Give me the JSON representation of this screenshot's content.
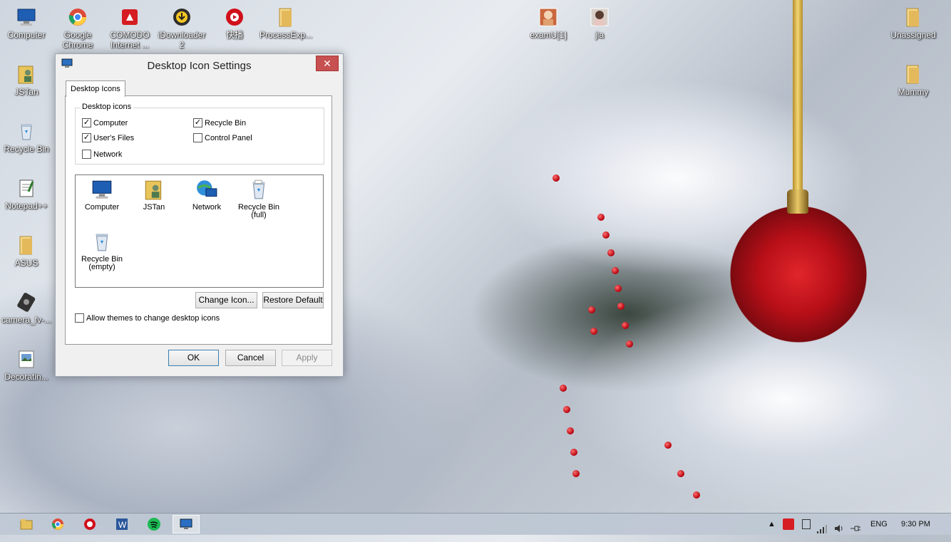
{
  "desktop": {
    "icons_left": [
      {
        "label": "Computer",
        "icon": "computer-icon"
      },
      {
        "label": "JSTan",
        "icon": "user-folder-icon"
      },
      {
        "label": "Recycle Bin",
        "icon": "recycle-bin-icon"
      },
      {
        "label": "Notepad++",
        "icon": "notepad-plus-plus-icon"
      },
      {
        "label": "ASUS",
        "icon": "folder-icon"
      },
      {
        "label": "camera_fv-...",
        "icon": "camera-shortcut-icon"
      },
      {
        "label": "Decoratin...",
        "icon": "image-file-icon"
      }
    ],
    "icons_top": [
      {
        "label": "Google Chrome",
        "icon": "chrome-icon"
      },
      {
        "label": "COMODO Internet ...",
        "icon": "comodo-icon"
      },
      {
        "label": "iDownloader 2",
        "icon": "idownloader-icon"
      },
      {
        "label": "快播",
        "icon": "qvod-player-icon"
      },
      {
        "label": "ProcessExp...",
        "icon": "folder-icon"
      }
    ],
    "icons_top_right": [
      {
        "label": "examU[1]",
        "icon": "image-thumbnail-icon"
      },
      {
        "label": "jia",
        "icon": "image-thumbnail-icon"
      }
    ],
    "icons_right": [
      {
        "label": "Unassigned",
        "icon": "folder-icon"
      },
      {
        "label": "Mummy",
        "icon": "folder-icon"
      }
    ]
  },
  "dialog": {
    "title": "Desktop Icon Settings",
    "close_glyph": "✕",
    "tab_label": "Desktop Icons",
    "group_label": "Desktop icons",
    "checkboxes": [
      {
        "label": "Computer",
        "checked": true
      },
      {
        "label": "Recycle Bin",
        "checked": true
      },
      {
        "label": "User's Files",
        "checked": true
      },
      {
        "label": "Control Panel",
        "checked": false
      },
      {
        "label": "Network",
        "checked": false
      }
    ],
    "icon_list": [
      {
        "label": "Computer",
        "icon": "computer-icon"
      },
      {
        "label": "JSTan",
        "icon": "user-folder-icon"
      },
      {
        "label": "Network",
        "icon": "network-icon"
      },
      {
        "label": "Recycle Bin (full)",
        "line1": "Recycle Bin",
        "line2": "(full)",
        "icon": "recycle-bin-full-icon"
      },
      {
        "label": "Recycle Bin (empty)",
        "line1": "Recycle Bin",
        "line2": "(empty)",
        "icon": "recycle-bin-empty-icon"
      }
    ],
    "change_icon_label": "Change Icon...",
    "restore_default_label": "Restore Default",
    "allow_themes_label": "Allow themes to change desktop icons",
    "allow_themes_checked": false,
    "ok_label": "OK",
    "cancel_label": "Cancel",
    "apply_label": "Apply"
  },
  "taskbar": {
    "buttons": [
      "file-explorer-icon",
      "chrome-icon",
      "qvod-player-icon",
      "word-icon",
      "spotify-icon",
      "desktop-icon-settings-icon"
    ],
    "tray": {
      "overflow_glyph": "▲",
      "language": "ENG",
      "time": "9:30 PM"
    }
  },
  "colors": {
    "close_button": "#c75050",
    "ornament_red": "#c4101a",
    "taskbar": "#bec8d4"
  }
}
